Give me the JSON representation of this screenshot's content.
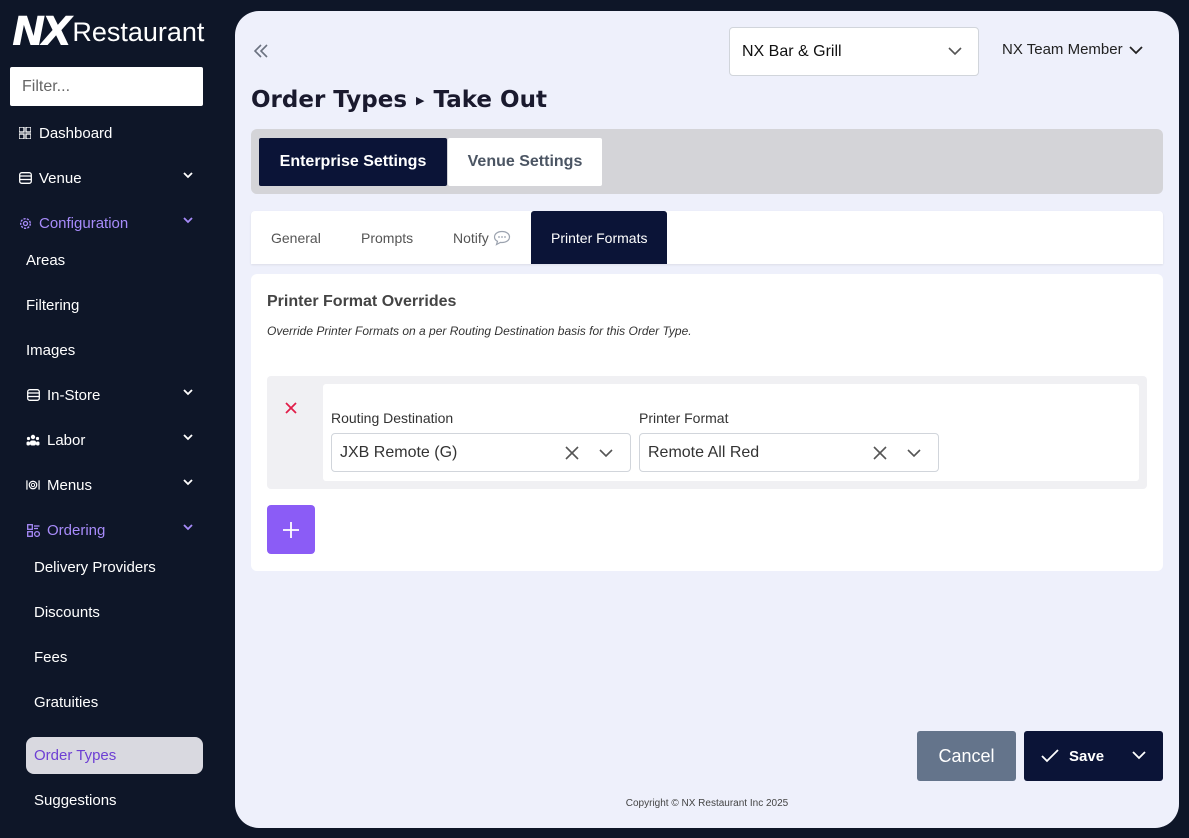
{
  "brand": {
    "logo_mark": "NX",
    "logo_text": "Restaurant"
  },
  "sidebar": {
    "filter_placeholder": "Filter...",
    "items": [
      {
        "label": "Dashboard",
        "icon": "dashboard-icon"
      },
      {
        "label": "Venue",
        "icon": "venue-icon"
      },
      {
        "label": "Configuration",
        "icon": "gear-icon"
      },
      {
        "label": "In-Store",
        "icon": "store-icon"
      },
      {
        "label": "Labor",
        "icon": "users-icon"
      },
      {
        "label": "Menus",
        "icon": "menu-icon"
      },
      {
        "label": "Ordering",
        "icon": "ordering-icon"
      }
    ],
    "config_sub": [
      "Areas",
      "Filtering",
      "Images"
    ],
    "ordering_sub": [
      "Delivery Providers",
      "Discounts",
      "Fees",
      "Gratuities",
      "Order Types",
      "Suggestions"
    ]
  },
  "header": {
    "venue": "NX Bar & Grill",
    "user": "NX Team Member",
    "breadcrumb_parent": "Order Types",
    "breadcrumb_current": "Take Out"
  },
  "scope": {
    "enterprise": "Enterprise Settings",
    "venue": "Venue Settings"
  },
  "tabs": [
    "General",
    "Prompts",
    "Notify",
    "Printer Formats"
  ],
  "card": {
    "title": "Printer Format Overrides",
    "description": "Override Printer Formats on a per Routing Destination basis for this Order Type.",
    "routing_label": "Routing Destination",
    "routing_value": "JXB Remote (G)",
    "format_label": "Printer Format",
    "format_value": "Remote All Red"
  },
  "actions": {
    "cancel": "Cancel",
    "save": "Save"
  },
  "footer": "Copyright © NX Restaurant Inc 2025",
  "colors": {
    "accent": "#8b5cf6",
    "navy": "#0b1437",
    "danger": "#e11d48"
  }
}
